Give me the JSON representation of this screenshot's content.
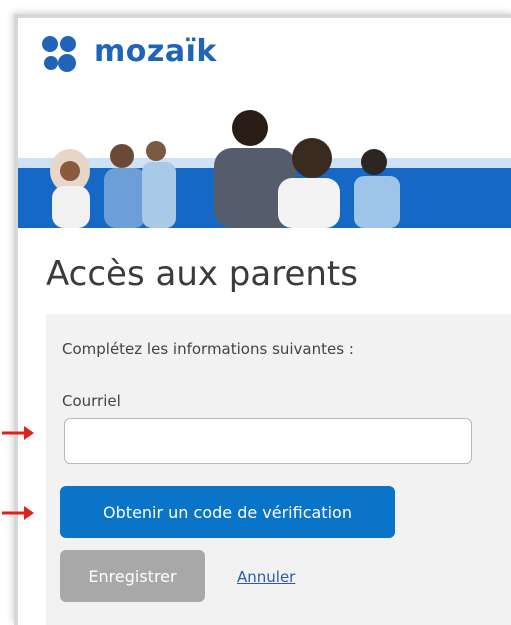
{
  "brand": {
    "name": "mozaïk",
    "color": "#1f64b8"
  },
  "page": {
    "title": "Accès aux parents"
  },
  "form": {
    "instructions": "Complétez les informations suivantes :",
    "email_label": "Courriel",
    "email_value": "",
    "get_code_button": "Obtenir un code de vérification",
    "save_button": "Enregistrer",
    "cancel_link": "Annuler"
  },
  "colors": {
    "primary_button": "#0a74c9",
    "disabled_button": "#a8a8a8",
    "banner_blue": "#1668c7",
    "annotation_arrow": "#e0201b"
  }
}
